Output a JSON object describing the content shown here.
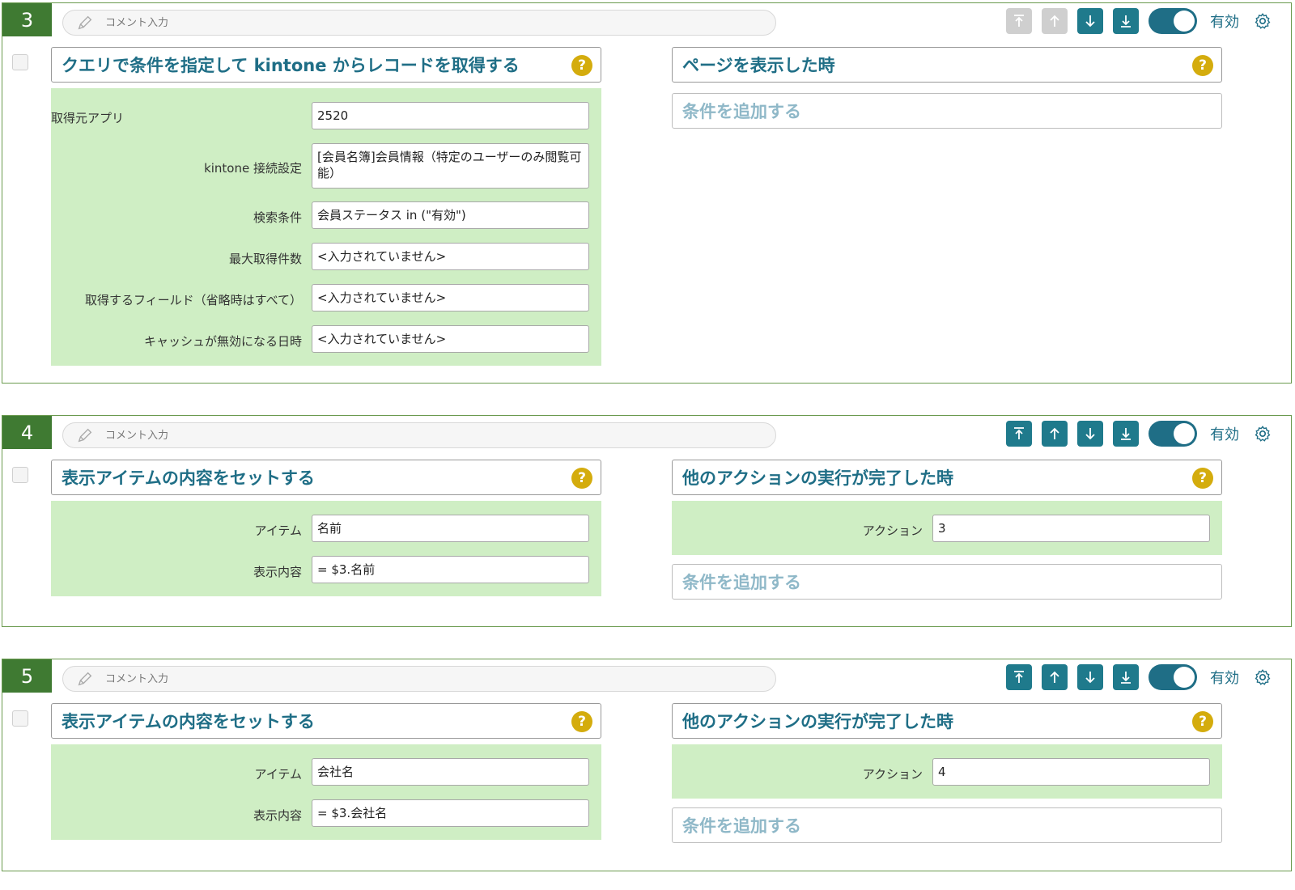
{
  "comment_placeholder": "コメント入力",
  "enabled_label": "有効",
  "help_glyph": "?",
  "add_condition_label": "条件を追加する",
  "colors": {
    "accent": "#1f6e86",
    "header_green": "#3f7a32",
    "panel_green": "#cfeec4",
    "help_yellow": "#d4ac0d"
  },
  "blocks": [
    {
      "number": "3",
      "action_title": "クエリで条件を指定して kintone からレコードを取得する",
      "trigger_title": "ページを表示した時",
      "fields": [
        {
          "label": "取得元アプリ",
          "value": "2520"
        },
        {
          "label": "kintone 接続設定",
          "value": "[会員名簿]会員情報（特定のユーザーのみ閲覧可能）"
        },
        {
          "label": "検索条件",
          "value": "会員ステータス in (\"有効\")"
        },
        {
          "label": "最大取得件数",
          "value": "<入力されていません>"
        },
        {
          "label": "取得するフィールド（省略時はすべて）",
          "value": "<入力されていません>"
        },
        {
          "label": "キャッシュが無効になる日時",
          "value": "<入力されていません>"
        }
      ]
    },
    {
      "number": "4",
      "action_title": "表示アイテムの内容をセットする",
      "trigger_title": "他のアクションの実行が完了した時",
      "fields": [
        {
          "label": "アイテム",
          "value": "名前"
        },
        {
          "label": "表示内容",
          "value": "= $3.名前"
        }
      ],
      "trigger_field": {
        "label": "アクション",
        "value": "3"
      }
    },
    {
      "number": "5",
      "action_title": "表示アイテムの内容をセットする",
      "trigger_title": "他のアクションの実行が完了した時",
      "fields": [
        {
          "label": "アイテム",
          "value": "会社名"
        },
        {
          "label": "表示内容",
          "value": "= $3.会社名"
        }
      ],
      "trigger_field": {
        "label": "アクション",
        "value": "4"
      }
    }
  ]
}
